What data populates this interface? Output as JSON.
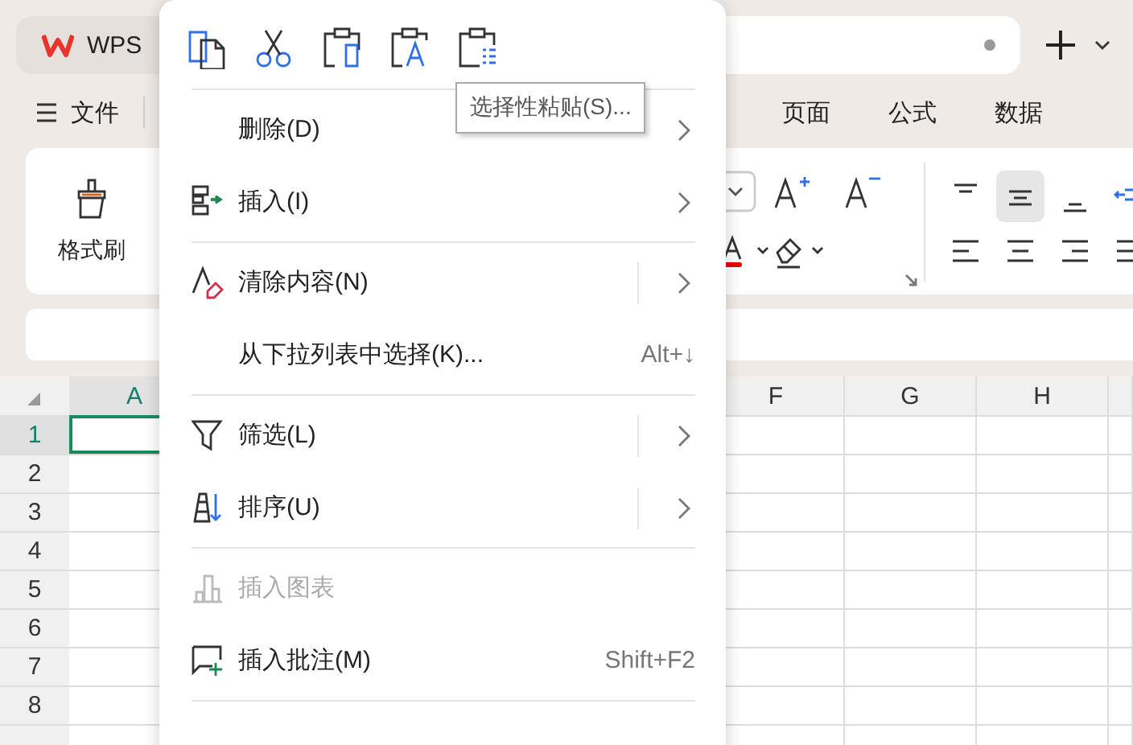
{
  "tabs": [
    {
      "label": "WPS",
      "selected": true
    }
  ],
  "menu_bar": {
    "file": "文件",
    "tabs": [
      {
        "label": "页面"
      },
      {
        "label": "公式"
      },
      {
        "label": "数据"
      }
    ]
  },
  "ribbon": {
    "format_painter": "格式刷",
    "align_buttons": [
      {
        "selected": false
      },
      {
        "selected": true
      },
      {
        "selected": false
      },
      {
        "selected": false
      }
    ]
  },
  "grid": {
    "columns": [
      {
        "label": "A",
        "selected": true
      },
      {
        "label": "F",
        "selected": false
      },
      {
        "label": "G",
        "selected": false
      },
      {
        "label": "H",
        "selected": false
      }
    ],
    "rows": [
      {
        "label": "1",
        "selected": true
      },
      {
        "label": "2",
        "selected": false
      },
      {
        "label": "3",
        "selected": false
      },
      {
        "label": "4",
        "selected": false
      },
      {
        "label": "5",
        "selected": false
      },
      {
        "label": "6",
        "selected": false
      },
      {
        "label": "7",
        "selected": false
      },
      {
        "label": "8",
        "selected": false
      }
    ]
  },
  "context_menu": {
    "tooltip": "选择性粘贴(S)...",
    "items": [
      {
        "kind": "item",
        "label": "删除(D)",
        "submenu": true,
        "split": false,
        "disabled": false
      },
      {
        "kind": "item",
        "label": "插入(I)",
        "submenu": true,
        "split": false,
        "disabled": false
      },
      {
        "kind": "separator"
      },
      {
        "kind": "item",
        "label": "清除内容(N)",
        "submenu": true,
        "split": true,
        "disabled": false
      },
      {
        "kind": "item",
        "label": "从下拉列表中选择(K)...",
        "shortcut": "Alt+↓",
        "submenu": false,
        "split": false,
        "disabled": false
      },
      {
        "kind": "separator"
      },
      {
        "kind": "item",
        "label": "筛选(L)",
        "submenu": true,
        "split": true,
        "disabled": false
      },
      {
        "kind": "item",
        "label": "排序(U)",
        "submenu": true,
        "split": true,
        "disabled": false
      },
      {
        "kind": "separator"
      },
      {
        "kind": "item",
        "label": "插入图表",
        "submenu": false,
        "split": false,
        "disabled": true
      },
      {
        "kind": "item",
        "label": "插入批注(M)",
        "shortcut": "Shift+F2",
        "submenu": false,
        "split": false,
        "disabled": false
      },
      {
        "kind": "separator"
      }
    ]
  }
}
